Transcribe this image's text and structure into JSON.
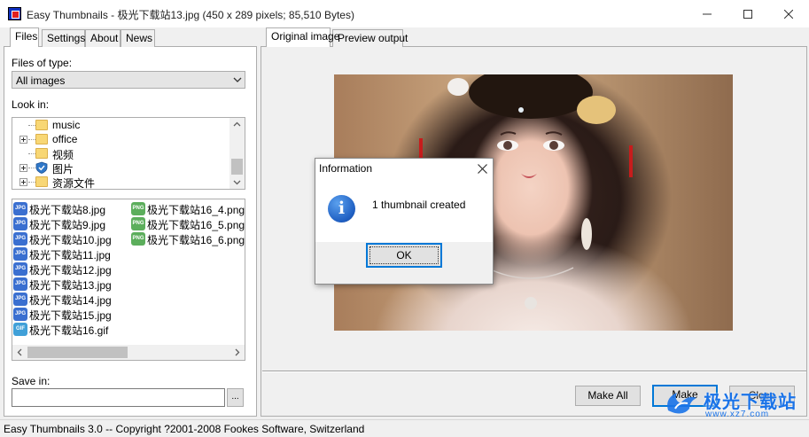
{
  "window": {
    "title": "Easy Thumbnails - 极光下载站13.jpg  (450 x 289 pixels;  85,510 Bytes)"
  },
  "left_tabs": [
    {
      "label": "Files",
      "active": true
    },
    {
      "label": "Settings",
      "active": false
    },
    {
      "label": "About",
      "active": false
    },
    {
      "label": "News",
      "active": false
    }
  ],
  "files": {
    "type_label": "Files of type:",
    "type_value": "All images",
    "look_in_label": "Look in:",
    "tree": [
      {
        "label": "music",
        "icon": "folder-icon",
        "expander": false
      },
      {
        "label": "office",
        "icon": "folder-icon",
        "expander": true
      },
      {
        "label": "视频",
        "icon": "folder-icon",
        "expander": false
      },
      {
        "label": "图片",
        "icon": "shield-folder-icon",
        "expander": true
      },
      {
        "label": "资源文件",
        "icon": "folder-icon",
        "expander": true
      }
    ],
    "list_col1": [
      {
        "name": "极光下载站8.jpg",
        "type": "JPG"
      },
      {
        "name": "极光下载站9.jpg",
        "type": "JPG"
      },
      {
        "name": "极光下载站10.jpg",
        "type": "JPG"
      },
      {
        "name": "极光下载站11.jpg",
        "type": "JPG"
      },
      {
        "name": "极光下载站12.jpg",
        "type": "JPG"
      },
      {
        "name": "极光下载站13.jpg",
        "type": "JPG"
      },
      {
        "name": "极光下载站14.jpg",
        "type": "JPG"
      },
      {
        "name": "极光下载站15.jpg",
        "type": "JPG"
      },
      {
        "name": "极光下载站16.gif",
        "type": "GIF"
      }
    ],
    "list_col2": [
      {
        "name": "极光下载站16_4.png",
        "type": "PNG"
      },
      {
        "name": "极光下载站16_5.png",
        "type": "PNG"
      },
      {
        "name": "极光下载站16_6.png",
        "type": "PNG"
      }
    ],
    "save_in_label": "Save in:",
    "save_in_value": "",
    "browse_label": "..."
  },
  "right_tabs": [
    {
      "label": "Original image",
      "active": true
    },
    {
      "label": "Preview output",
      "active": false
    }
  ],
  "buttons": {
    "make_all": "Make All",
    "make": "Make",
    "close": "Close"
  },
  "dialog": {
    "title": "Information",
    "message": "1 thumbnail created",
    "ok_label": "OK",
    "icon": "info-icon"
  },
  "status": {
    "text": "Easy Thumbnails 3.0 -- Copyright ?2001-2008 Fookes Software, Switzerland"
  },
  "watermark": {
    "line1": "极光下载站",
    "line2": "www.xz7.com"
  },
  "colors": {
    "accent": "#0078d7",
    "folder": "#f8d775",
    "watermark": "#1a73e8"
  }
}
